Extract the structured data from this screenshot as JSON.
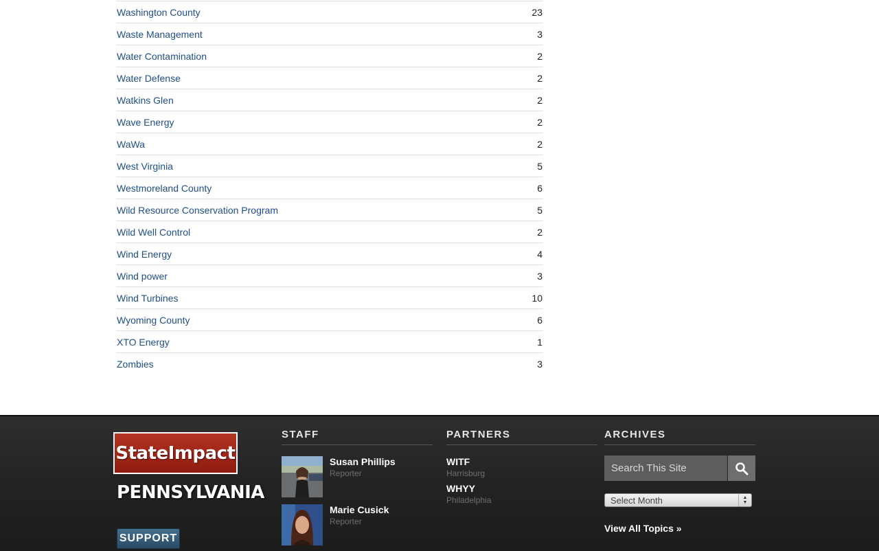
{
  "topics": [
    {
      "name": "Washington County",
      "count": "23"
    },
    {
      "name": "Waste Management",
      "count": "3"
    },
    {
      "name": "Water Contamination",
      "count": "2"
    },
    {
      "name": "Water Defense",
      "count": "2"
    },
    {
      "name": "Watkins Glen",
      "count": "2"
    },
    {
      "name": "Wave Energy",
      "count": "2"
    },
    {
      "name": "WaWa",
      "count": "2"
    },
    {
      "name": "West Virginia",
      "count": "5"
    },
    {
      "name": "Westmoreland County",
      "count": "6"
    },
    {
      "name": "Wild Resource Conservation Program",
      "count": "5"
    },
    {
      "name": "Wild Well Control",
      "count": "2"
    },
    {
      "name": "Wind Energy",
      "count": "4"
    },
    {
      "name": "Wind power",
      "count": "3"
    },
    {
      "name": "Wind Turbines",
      "count": "10"
    },
    {
      "name": "Wyoming County",
      "count": "6"
    },
    {
      "name": "XTO Energy",
      "count": "1"
    },
    {
      "name": "Zombies",
      "count": "3"
    }
  ],
  "footer": {
    "brand": {
      "logo_text": "StateImpact",
      "state": "PENNSYLVANIA"
    },
    "support_label": "SUPPORT",
    "staff": {
      "heading": "STAFF",
      "members": [
        {
          "name": "Susan Phillips",
          "role": "Reporter"
        },
        {
          "name": "Marie Cusick",
          "role": "Reporter"
        }
      ]
    },
    "partners": {
      "heading": "PARTNERS",
      "items": [
        {
          "name": "WITF",
          "city": "Harrisburg"
        },
        {
          "name": "WHYY",
          "city": "Philadelphia"
        }
      ]
    },
    "archives": {
      "heading": "ARCHIVES",
      "search_placeholder": "Search This Site",
      "month_select": "Select Month",
      "view_all": "View All Topics »"
    }
  },
  "colors": {
    "link": "#1f4f8a",
    "brand_red": "#a42a1b",
    "footer_bg": "#262626",
    "support_blue": "#35597a"
  },
  "icons": {
    "search": "search-icon",
    "select_arrows": "select-arrows-icon"
  }
}
